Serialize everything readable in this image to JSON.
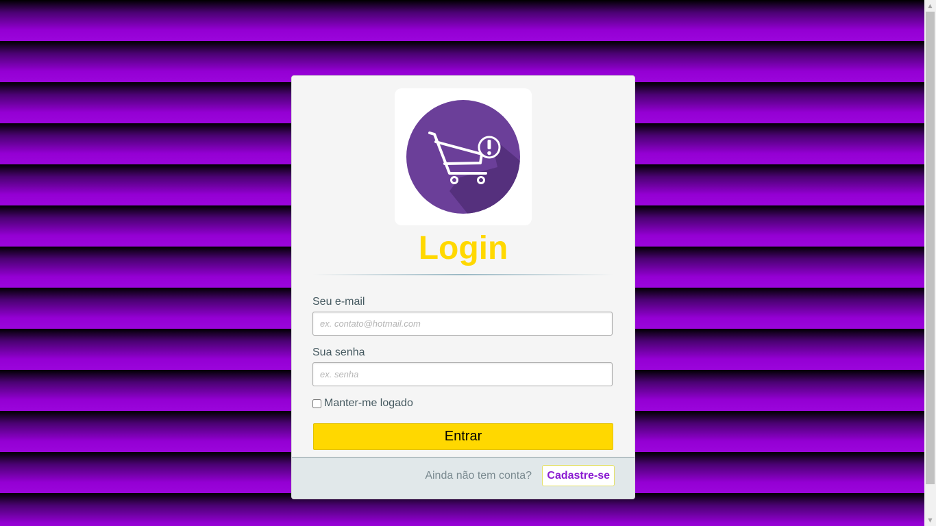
{
  "login": {
    "title": "Login",
    "email_label": "Seu e-mail",
    "email_placeholder": "ex. contato@hotmail.com",
    "email_value": "",
    "password_label": "Sua senha",
    "password_placeholder": "ex. senha",
    "password_value": "",
    "remember_label": "Manter-me logado",
    "remember_checked": false,
    "submit_label": "Entrar"
  },
  "footer": {
    "prompt": "Ainda não tem conta?",
    "signup_label": "Cadastre-se"
  },
  "logo": {
    "icon": "shopping-cart-alert-icon"
  },
  "colors": {
    "background_accent": "#9400d3",
    "title": "#ffd800",
    "button": "#ffd800",
    "logo_circle": "#6b3f99",
    "signup_link": "#8a1bd1"
  }
}
